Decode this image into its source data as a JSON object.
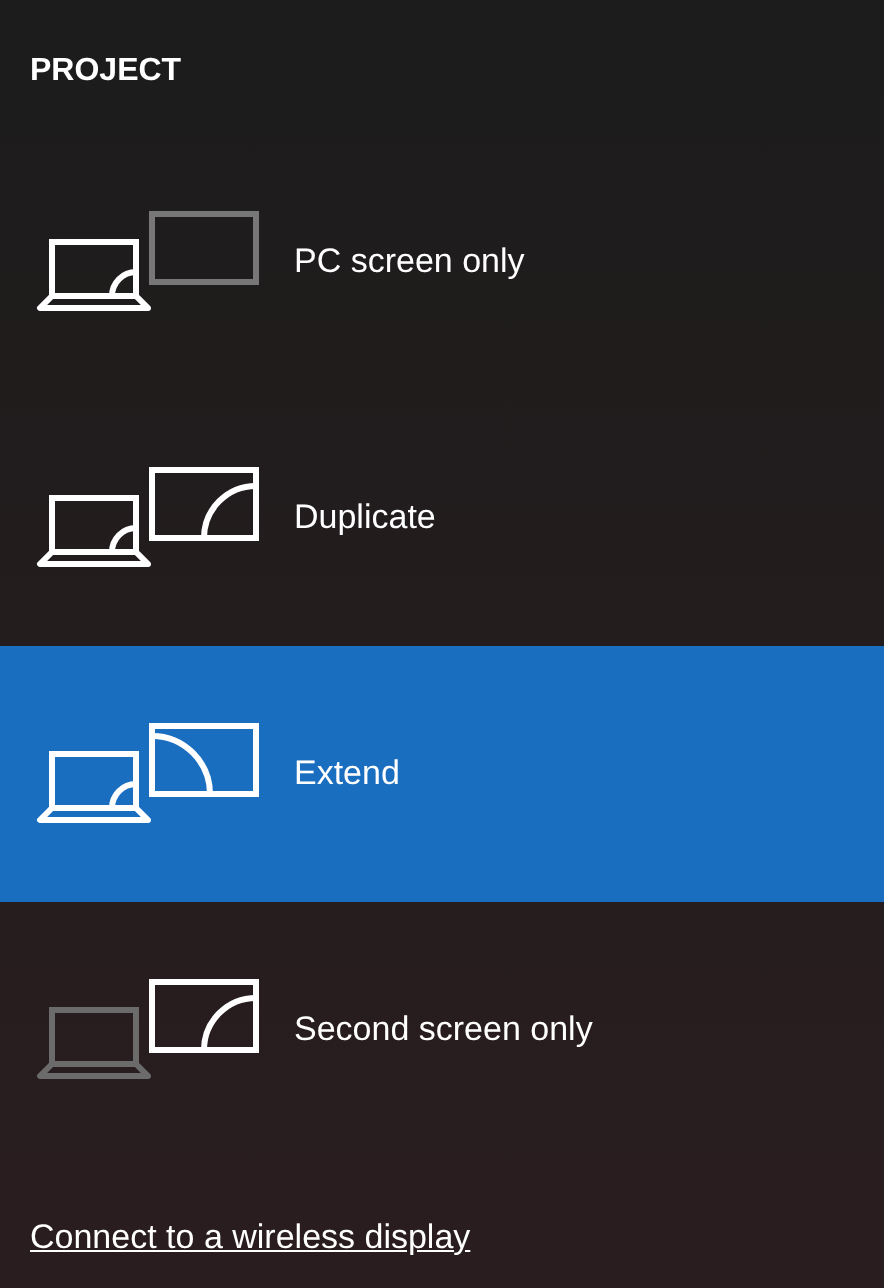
{
  "title": "PROJECT",
  "options": [
    {
      "kind": "pc_only",
      "label": "PC screen only",
      "selected": false
    },
    {
      "kind": "duplicate",
      "label": "Duplicate",
      "selected": false
    },
    {
      "kind": "extend",
      "label": "Extend",
      "selected": true
    },
    {
      "kind": "second_only",
      "label": "Second screen only",
      "selected": false
    }
  ],
  "link": "Connect to a wireless display"
}
